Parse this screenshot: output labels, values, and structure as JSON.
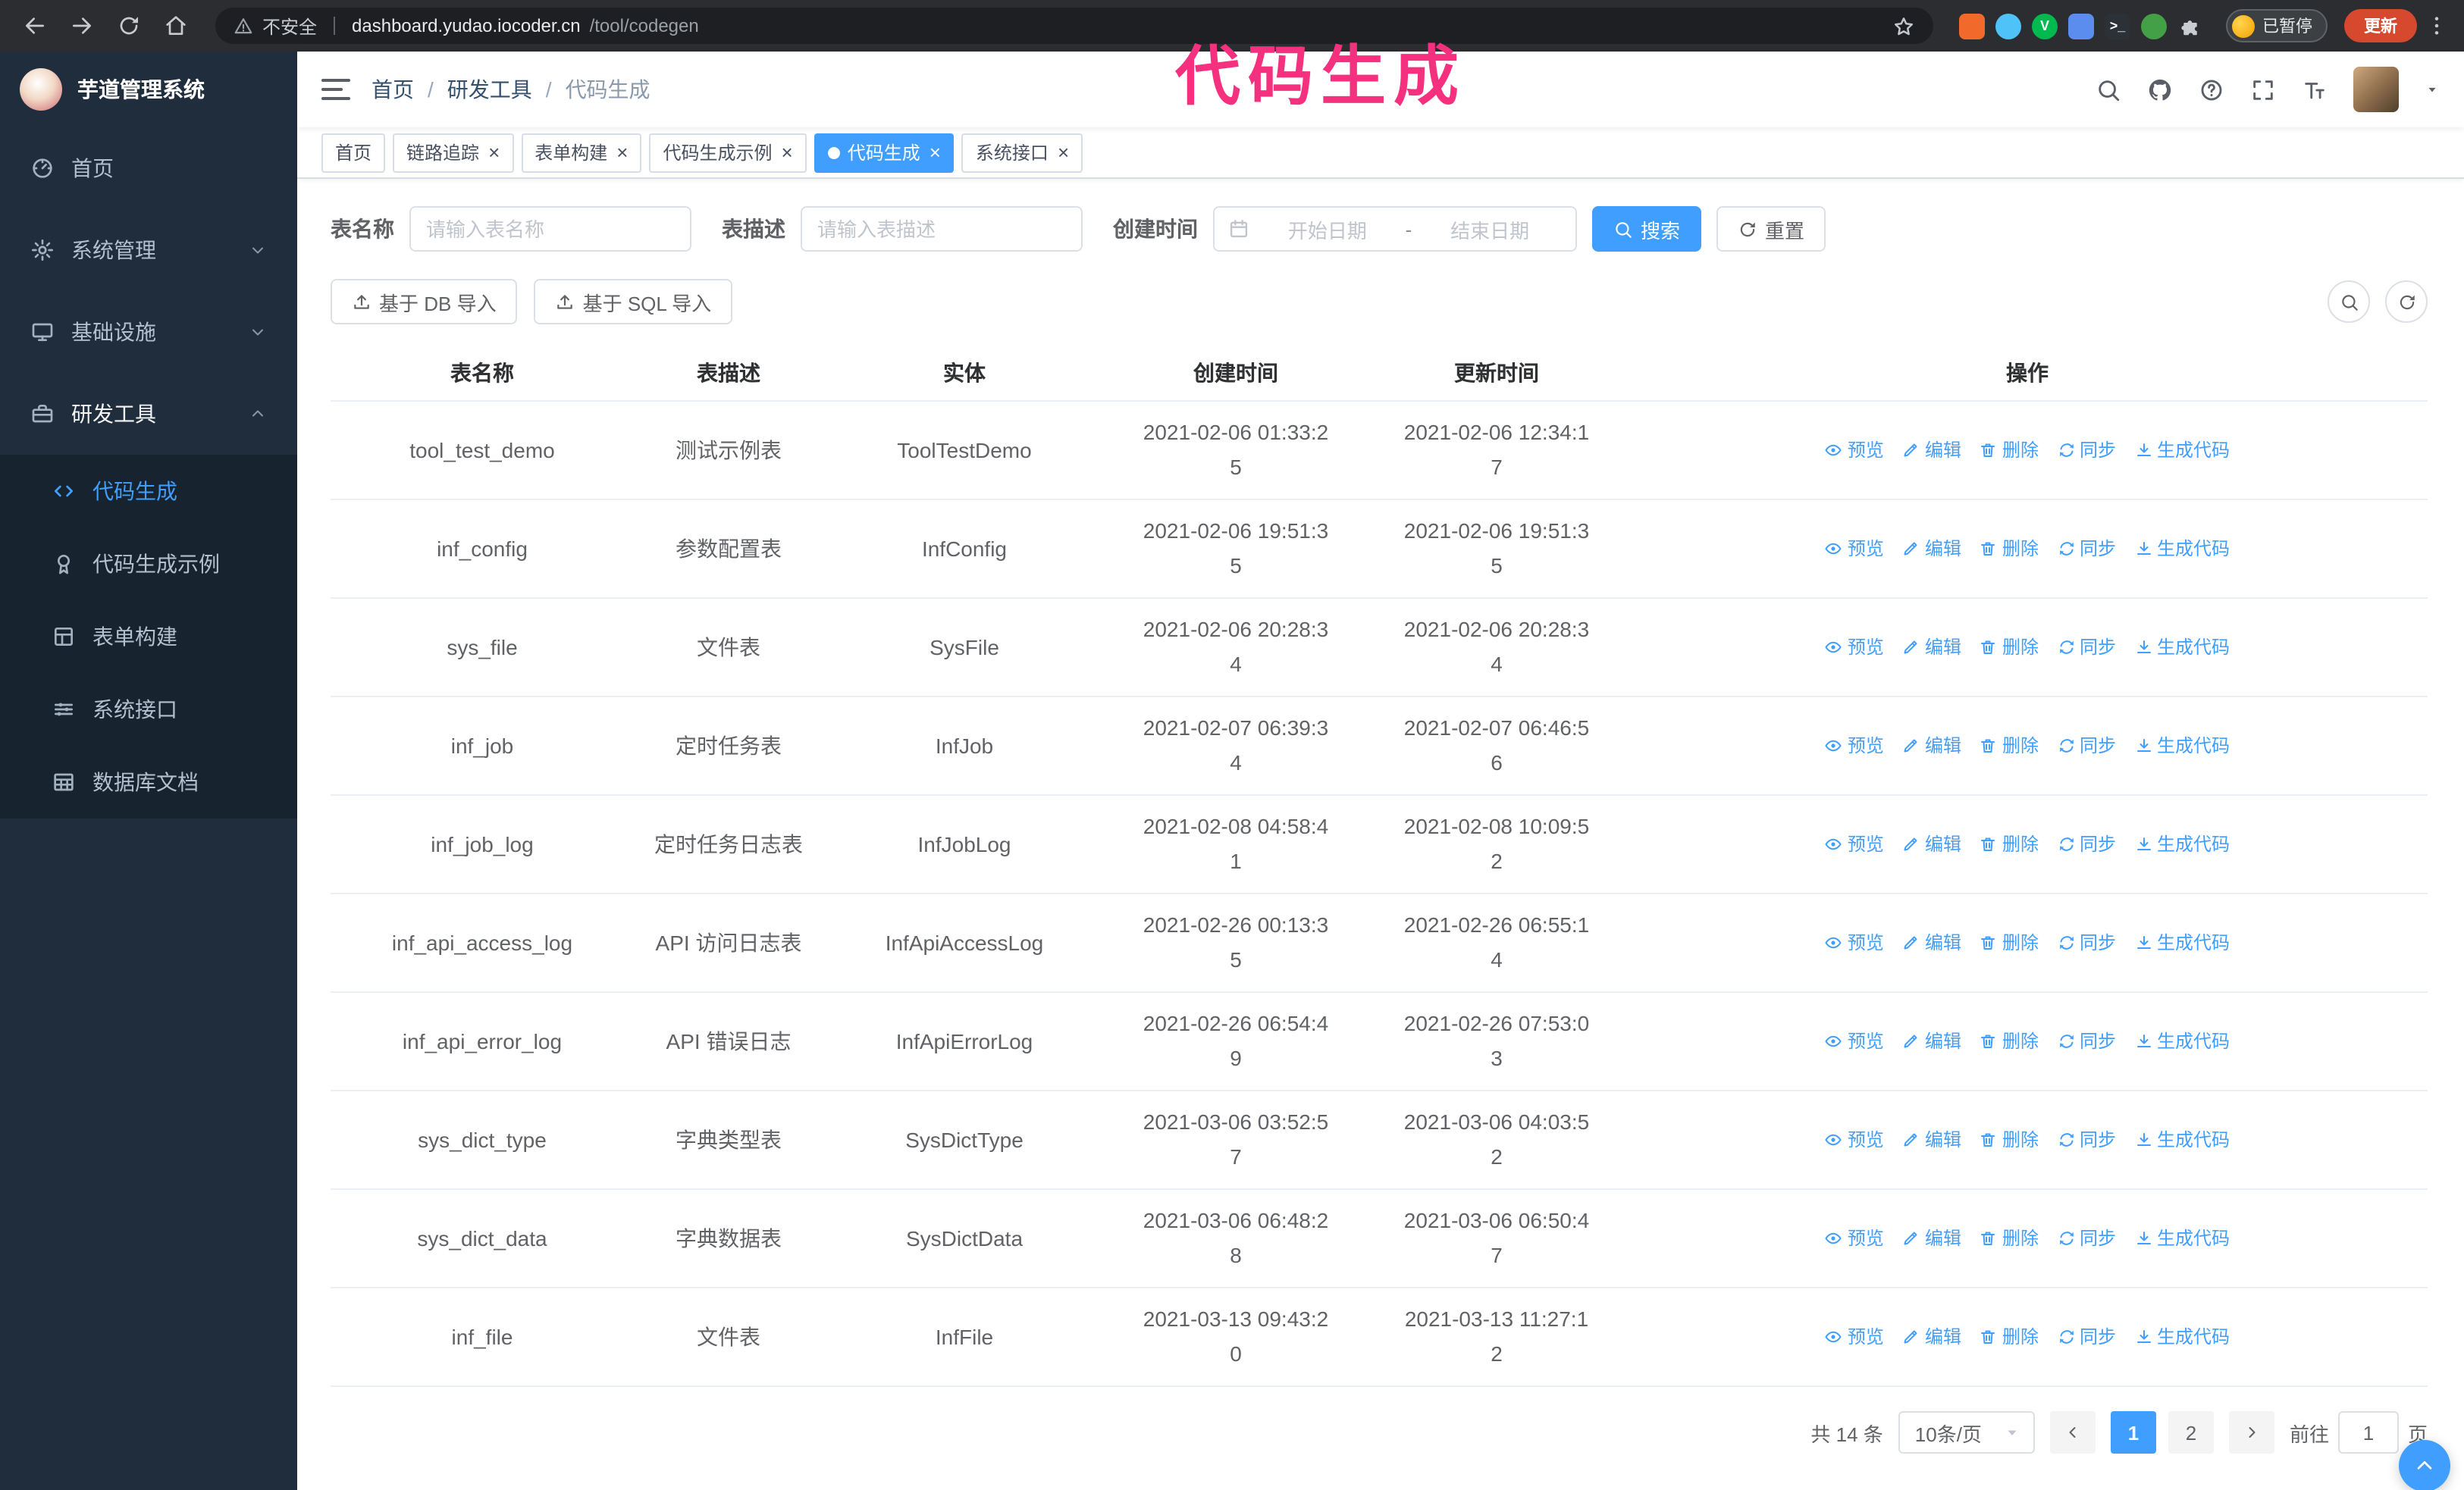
{
  "browser": {
    "security_label": "不安全",
    "url_domain": "dashboard.yudao.iocoder.cn",
    "url_path": "/tool/codegen",
    "paused_badge": "已暂停",
    "update_button": "更新",
    "extensions": [
      {
        "name": "extension-orange-icon",
        "color": "#f26a2b",
        "shape": "square",
        "glyph": ""
      },
      {
        "name": "extension-blue-drop-icon",
        "color": "#4fc3f7",
        "shape": "circle",
        "glyph": ""
      },
      {
        "name": "extension-green-v-icon",
        "color": "#00b94f",
        "shape": "circle",
        "glyph": "V"
      },
      {
        "name": "extension-people-icon",
        "color": "#5b8def",
        "shape": "square",
        "glyph": ""
      },
      {
        "name": "extension-terminal-icon",
        "color": "#2b3137",
        "shape": "square",
        "glyph": ">_"
      },
      {
        "name": "extension-leaf-icon",
        "color": "#43a047",
        "shape": "circle",
        "glyph": ""
      },
      {
        "name": "extensions-puzzle-icon",
        "color": "#c9ccd1",
        "shape": "square",
        "glyph": "puzzle"
      }
    ]
  },
  "annotation": {
    "text": "代码生成",
    "color": "#f5317f"
  },
  "sidebar": {
    "logo_title": "芋道管理系统",
    "menu": [
      {
        "key": "home",
        "label": "首页",
        "icon": "dashboard-icon",
        "type": "item"
      },
      {
        "key": "system-management",
        "label": "系统管理",
        "icon": "gear-icon",
        "type": "group",
        "chevron": "down"
      },
      {
        "key": "infrastructure",
        "label": "基础设施",
        "icon": "monitor-icon",
        "type": "group",
        "chevron": "down"
      },
      {
        "key": "dev-tools",
        "label": "研发工具",
        "icon": "toolbox-icon",
        "type": "group",
        "chevron": "up",
        "expanded": true
      },
      {
        "key": "code-generation",
        "label": "代码生成",
        "icon": "code-icon",
        "type": "sub",
        "active": true
      },
      {
        "key": "code-generation-example",
        "label": "代码生成示例",
        "icon": "badge-icon",
        "type": "sub"
      },
      {
        "key": "form-builder",
        "label": "表单构建",
        "icon": "form-icon",
        "type": "sub"
      },
      {
        "key": "system-api",
        "label": "系统接口",
        "icon": "api-icon",
        "type": "sub"
      },
      {
        "key": "database-doc",
        "label": "数据库文档",
        "icon": "db-icon",
        "type": "sub"
      }
    ]
  },
  "header": {
    "breadcrumb": [
      "首页",
      "研发工具",
      "代码生成"
    ],
    "separator": "/"
  },
  "tabs": [
    {
      "key": "home",
      "label": "首页",
      "closable": false,
      "active": false
    },
    {
      "key": "trace",
      "label": "链路追踪",
      "closable": true,
      "active": false
    },
    {
      "key": "form-builder",
      "label": "表单构建",
      "closable": true,
      "active": false
    },
    {
      "key": "codegen-example",
      "label": "代码生成示例",
      "closable": true,
      "active": false
    },
    {
      "key": "codegen",
      "label": "代码生成",
      "closable": true,
      "active": true
    },
    {
      "key": "system-api",
      "label": "系统接口",
      "closable": true,
      "active": false
    }
  ],
  "filters": {
    "name_label": "表名称",
    "name_placeholder": "请输入表名称",
    "desc_label": "表描述",
    "desc_placeholder": "请输入表描述",
    "time_label": "创建时间",
    "start_placeholder": "开始日期",
    "range_separator": "-",
    "end_placeholder": "结束日期",
    "search_button": "搜索",
    "reset_button": "重置"
  },
  "toolbar": {
    "import_db_button": "基于 DB 导入",
    "import_sql_button": "基于 SQL 导入"
  },
  "table": {
    "columns": [
      "表名称",
      "表描述",
      "实体",
      "创建时间",
      "更新时间",
      "操作"
    ],
    "row_actions": [
      {
        "label": "预览",
        "icon": "eye-icon"
      },
      {
        "label": "编辑",
        "icon": "edit-icon"
      },
      {
        "label": "删除",
        "icon": "delete-icon"
      },
      {
        "label": "同步",
        "icon": "sync-icon"
      },
      {
        "label": "生成代码",
        "icon": "download-icon"
      }
    ],
    "rows": [
      {
        "name": "tool_test_demo",
        "description": "测试示例表",
        "entity": "ToolTestDemo",
        "created": "2021-02-06 01:33:25",
        "updated": "2021-02-06 12:34:17"
      },
      {
        "name": "inf_config",
        "description": "参数配置表",
        "entity": "InfConfig",
        "created": "2021-02-06 19:51:35",
        "updated": "2021-02-06 19:51:35"
      },
      {
        "name": "sys_file",
        "description": "文件表",
        "entity": "SysFile",
        "created": "2021-02-06 20:28:34",
        "updated": "2021-02-06 20:28:34"
      },
      {
        "name": "inf_job",
        "description": "定时任务表",
        "entity": "InfJob",
        "created": "2021-02-07 06:39:34",
        "updated": "2021-02-07 06:46:56"
      },
      {
        "name": "inf_job_log",
        "description": "定时任务日志表",
        "entity": "InfJobLog",
        "created": "2021-02-08 04:58:41",
        "updated": "2021-02-08 10:09:52"
      },
      {
        "name": "inf_api_access_log",
        "description": "API 访问日志表",
        "entity": "InfApiAccessLog",
        "created": "2021-02-26 00:13:35",
        "updated": "2021-02-26 06:55:14"
      },
      {
        "name": "inf_api_error_log",
        "description": "API 错误日志",
        "entity": "InfApiErrorLog",
        "created": "2021-02-26 06:54:49",
        "updated": "2021-02-26 07:53:03"
      },
      {
        "name": "sys_dict_type",
        "description": "字典类型表",
        "entity": "SysDictType",
        "created": "2021-03-06 03:52:57",
        "updated": "2021-03-06 04:03:52"
      },
      {
        "name": "sys_dict_data",
        "description": "字典数据表",
        "entity": "SysDictData",
        "created": "2021-03-06 06:48:28",
        "updated": "2021-03-06 06:50:47"
      },
      {
        "name": "inf_file",
        "description": "文件表",
        "entity": "InfFile",
        "created": "2021-03-13 09:43:20",
        "updated": "2021-03-13 11:27:12"
      }
    ]
  },
  "pagination": {
    "total_text": "共 14 条",
    "page_size": "10条/页",
    "pages": [
      "1",
      "2"
    ],
    "current_page": "1",
    "goto_label": "前往",
    "goto_value": "1",
    "goto_suffix": "页"
  },
  "colors": {
    "accent": "#409eff",
    "sidebar_bg": "#1f2d3d",
    "active_tab": "#409eff",
    "annotation": "#f5317f"
  }
}
